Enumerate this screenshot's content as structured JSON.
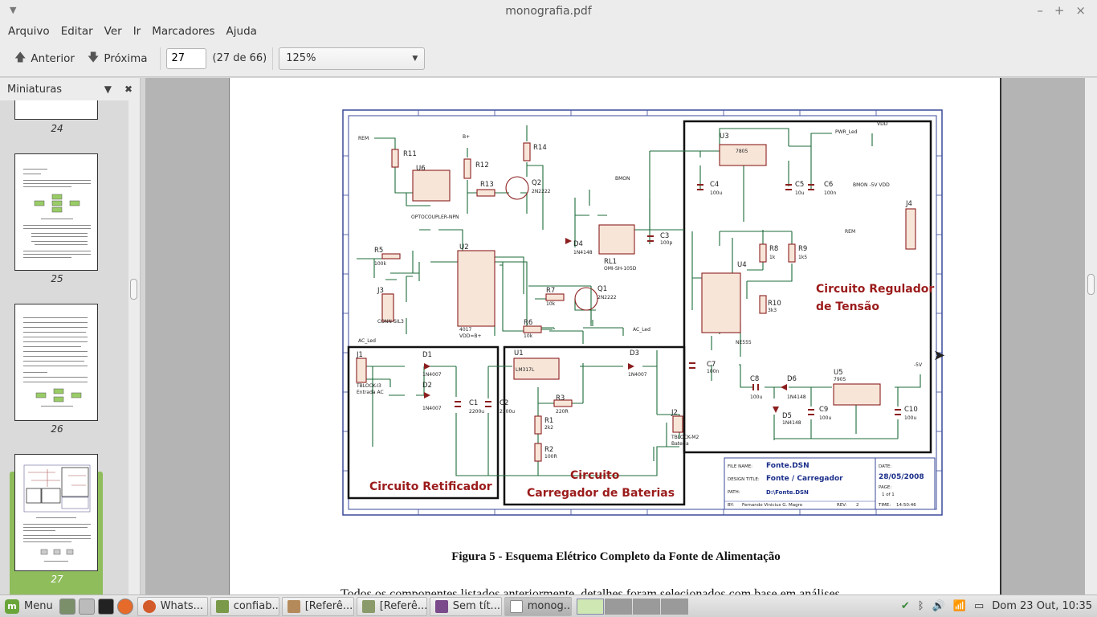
{
  "window": {
    "title": "monografia.pdf",
    "controls": [
      "–",
      "+",
      "×"
    ]
  },
  "menu": [
    "Arquivo",
    "Editar",
    "Ver",
    "Ir",
    "Marcadores",
    "Ajuda"
  ],
  "toolbar": {
    "prev_label": "Anterior",
    "next_label": "Próxima",
    "page_value": "27",
    "page_count": "(27 de 66)",
    "zoom_value": "125%"
  },
  "sidebar": {
    "title": "Miniaturas",
    "thumbnails": [
      {
        "label": "24"
      },
      {
        "label": "25"
      },
      {
        "label": "26"
      },
      {
        "label": "27",
        "selected": true
      }
    ]
  },
  "document": {
    "caption": "Figura 5 - Esquema Elétrico Completo da Fonte de Alimentação",
    "body_line": "Todos os componentes listados anteriormente, detalhes foram selecionados com base em análises",
    "schematic": {
      "blocks": {
        "regulador": [
          "Circuito Regulador",
          "de Tensão"
        ],
        "retificador": "Circuito Retificador",
        "carregador": [
          "Circuito",
          "Carregador de Baterias"
        ]
      },
      "titleblock": {
        "file_name_key": "FILE NAME:",
        "file_name": "Fonte.DSN",
        "design_title_key": "DESIGN TITLE:",
        "design_title": "Fonte / Carregador",
        "path_key": "PATH:",
        "path": "D:\\Fonte.DSN",
        "by_key": "BY:",
        "by": "Fernando Vinicius G. Magro",
        "rev_key": "REV:",
        "rev": "2",
        "date_key": "DATE:",
        "date": "28/05/2008",
        "page_key": "PAGE:",
        "page": "1   of   1",
        "time_key": "TIME:",
        "time": "14:50:46"
      },
      "labels": {
        "r11": "R11",
        "r12": "R12",
        "r13": "R13",
        "r14": "R14",
        "u6": "U6",
        "q2": "Q2",
        "q2v": "2N2222",
        "rem": "REM",
        "bplus": "B+",
        "opto": "OPTOCOUPLER-NPN",
        "u3": "U3",
        "u3v": "7805",
        "pwr": "PWR_Led",
        "vdd": "VDD",
        "c4": "C4",
        "c5": "C5",
        "c6": "C6",
        "c4v": "100u",
        "c5v": "10u",
        "c6v": "100n",
        "bmon": "BMON",
        "bmon2": "BMON  -5V   VDD",
        "j4": "J4",
        "rem2": "REM",
        "d4": "D4",
        "d4v": "1N4148",
        "rl1": "RL1",
        "rl1v": "OMI-SH-105D",
        "c3": "C3",
        "c3v": "100p",
        "r5": "R5",
        "r5v": "100k",
        "u2": "U2",
        "u2v": "4017",
        "vddb": "VDD=B+",
        "j3": "J3",
        "j3v": "CONN-SIL3",
        "r7": "R7",
        "r7v": "10k",
        "q1": "Q1",
        "q1v": "2N2222",
        "r6": "R6",
        "r6v": "10k",
        "acled": "AC_Led",
        "u4": "U4",
        "u4v": "NE555",
        "r8": "R8",
        "r8v": "1k",
        "r9": "R9",
        "r9v": "1k5",
        "r10": "R10",
        "r10v": "3k3",
        "c7": "C7",
        "c7v": "100n",
        "c8": "C8",
        "c8v": "100u",
        "d6": "D6",
        "d6v": "1N4148",
        "d5": "D5",
        "d5v": "1N4148",
        "u5": "U5",
        "u5v": "7905",
        "c9": "C9",
        "c9v": "100u",
        "c10": "C10",
        "c10v": "100u",
        "neg5": "-5V",
        "j1": "J1",
        "j1v": "TBLOCK-I3",
        "j1v2": "Entrada AC",
        "d1": "D1",
        "d2": "D2",
        "d1v": "1N4007",
        "d2v": "1N4007",
        "c1": "C1",
        "c2": "C2",
        "c1v": "2200u",
        "c2v": "2200u",
        "u1": "U1",
        "u1v": "LM317L",
        "r3": "R3",
        "r3v": "220R",
        "r1": "R1",
        "r1v": "2k2",
        "r2": "R2",
        "r2v": "100R",
        "d3": "D3",
        "d3v": "1N4007",
        "j2": "J2",
        "j2v": "TBLOCK-M2",
        "j2v2": "Bateria"
      }
    }
  },
  "taskbar": {
    "menu_label": "Menu",
    "tasks": [
      {
        "label": "Whats...",
        "color": "#d35a2a"
      },
      {
        "label": "confiab...",
        "color": "#7a9a4a"
      },
      {
        "label": "[Referê...",
        "color": "#b58a5a"
      },
      {
        "label": "[Referê...",
        "color": "#8a9a6a"
      },
      {
        "label": "Sem tít...",
        "color": "#7a4a8a"
      },
      {
        "label": "monog...",
        "color": "#888888",
        "active": true
      }
    ],
    "clock": "Dom 23 Out, 10:35"
  }
}
